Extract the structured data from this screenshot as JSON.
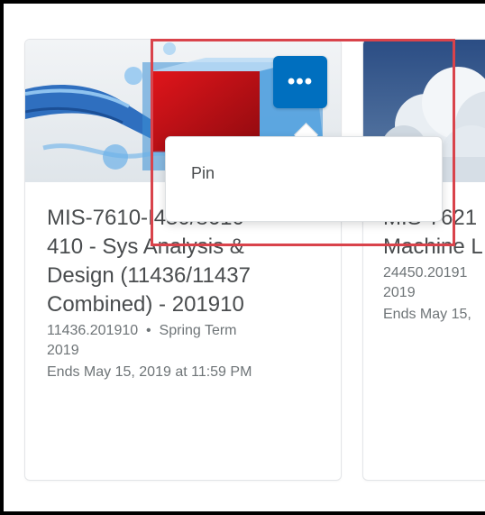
{
  "courses": [
    {
      "title": "MIS-7610-I430/8610-\n410 - Sys Analysis &\nDesign (11436/11437\nCombined) - 201910",
      "code": "11436.201910",
      "term": "Spring Term",
      "year": "2019",
      "ends": "Ends May 15, 2019 at 11:59 PM"
    },
    {
      "title": "MIS-7621\nMachine L",
      "code": "24450.20191",
      "year": "2019",
      "ends": "Ends May 15,"
    }
  ],
  "more_button": {
    "label": "•••"
  },
  "menu": {
    "items": [
      "Pin"
    ]
  },
  "colors": {
    "accent": "#006fbf",
    "highlight": "#d9434b",
    "title_text": "#494c4e",
    "meta_text": "#6e7477"
  },
  "icons": {
    "more": "ellipsis-icon",
    "separator": "bullet-icon"
  }
}
